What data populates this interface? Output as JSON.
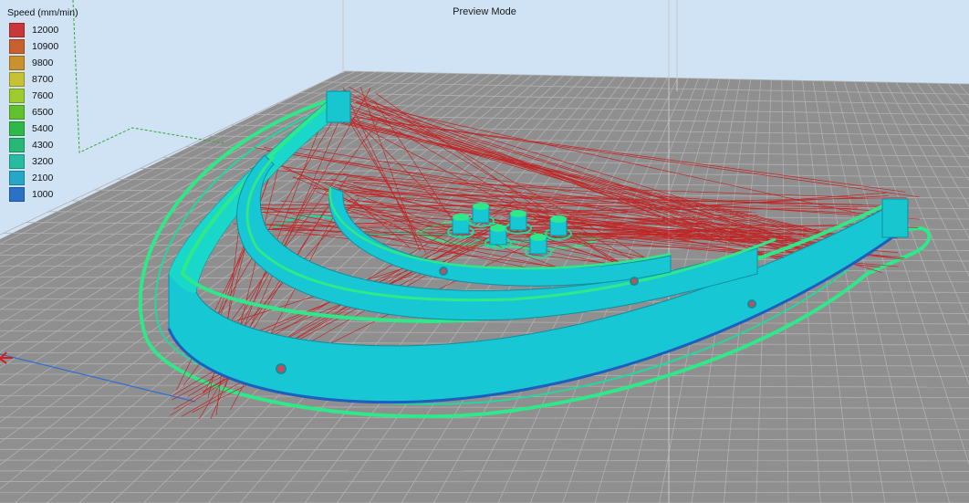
{
  "header": {
    "mode_title": "Preview Mode"
  },
  "legend": {
    "title": "Speed (mm/min)",
    "items": [
      {
        "label": "12000",
        "color": "#c8383a"
      },
      {
        "label": "10900",
        "color": "#c8612e"
      },
      {
        "label": "9800",
        "color": "#c9922c"
      },
      {
        "label": "8700",
        "color": "#c6c234"
      },
      {
        "label": "7600",
        "color": "#9fcb2e"
      },
      {
        "label": "6500",
        "color": "#63c02f"
      },
      {
        "label": "5400",
        "color": "#2fb84a"
      },
      {
        "label": "4300",
        "color": "#27b876"
      },
      {
        "label": "3200",
        "color": "#27bca0"
      },
      {
        "label": "2100",
        "color": "#25a8c6"
      },
      {
        "label": "1000",
        "color": "#2a72c6"
      }
    ]
  },
  "colors": {
    "background": "#cfe3f5",
    "bed": "#8f8f8f",
    "grid": "#b1b1b1",
    "part_fill": "#17c7d3",
    "outline": "#2ee889",
    "travel": "#c81414"
  }
}
